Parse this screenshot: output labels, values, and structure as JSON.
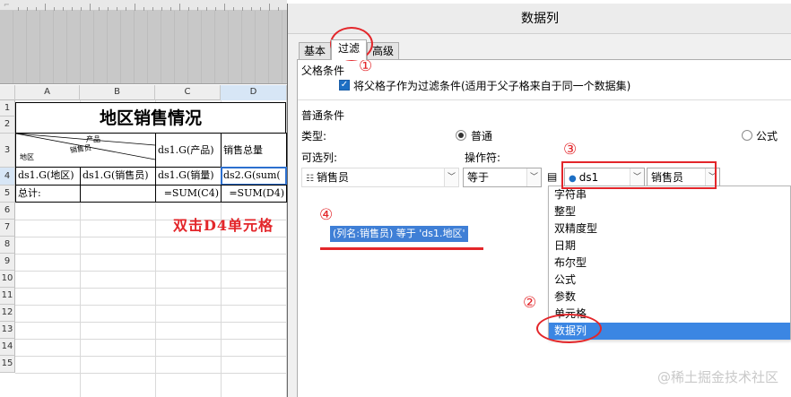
{
  "sheet": {
    "columns": [
      "A",
      "B",
      "C",
      "D"
    ],
    "rows": [
      "1",
      "2",
      "3",
      "4",
      "5",
      "6",
      "7",
      "8",
      "9",
      "10",
      "11",
      "12",
      "13",
      "14",
      "15"
    ],
    "title": "地区销售情况",
    "header": {
      "slash_top": "产品",
      "slash_mid": "销售员",
      "slash_left": "地区",
      "c3": "ds1.G(产品)",
      "d3": "销售总量"
    },
    "row4": {
      "a4": "ds1.G(地区)",
      "b4": "ds1.G(销售员)",
      "c4": "ds1.G(销量)",
      "d4": "ds2.G(sum("
    },
    "row5": {
      "a5": "总计:",
      "c5": "=SUM(C4)",
      "d5": "=SUM(D4)"
    },
    "annotation": "双击D4单元格"
  },
  "dialog": {
    "title": "数据列",
    "tabs": [
      "基本",
      "过滤",
      "高级"
    ],
    "active_tab": "过滤",
    "parent_section": "父格条件",
    "parent_checkbox_label": "将父格子作为过滤条件(适用于父子格来自于同一个数据集)",
    "parent_checked": true,
    "normal_section": "普通条件",
    "type_label": "类型:",
    "type_normal": "普通",
    "type_formula": "公式",
    "type_selected": "普通",
    "option_label": "可选列:",
    "operator_label": "操作符:",
    "option_value": "销售员",
    "operator_value": "等于",
    "dataset_value": "ds1",
    "column_value": "销售员",
    "filter_item": "(列名:销售员) 等于 'ds1.地区'",
    "menu_items": [
      "字符串",
      "整型",
      "双精度型",
      "日期",
      "布尔型",
      "公式",
      "参数",
      "单元格",
      "数据列"
    ],
    "menu_selected": "数据列"
  },
  "annotations": {
    "n1": "①",
    "n2": "②",
    "n3": "③",
    "n4": "④",
    "color": "#e3262a"
  },
  "watermark": "@稀土掘金技术社区"
}
